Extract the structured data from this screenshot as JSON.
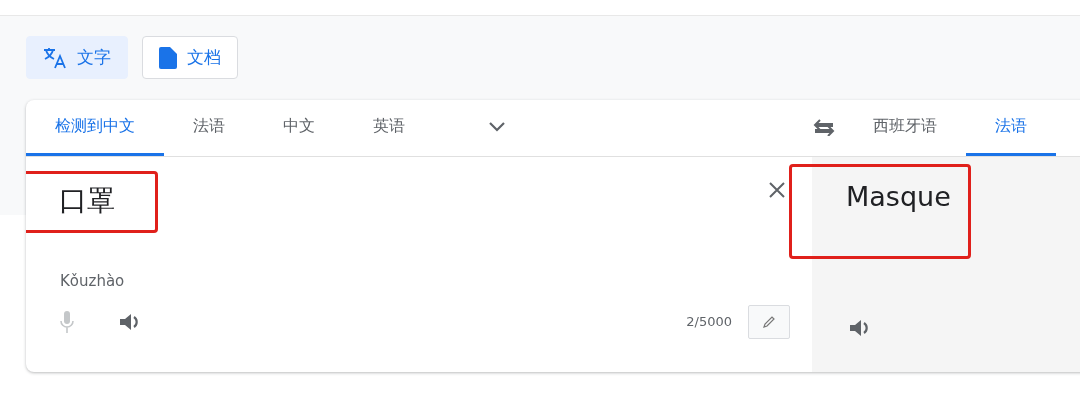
{
  "modes": [
    {
      "kind": "text",
      "label": "文字",
      "selected": true
    },
    {
      "kind": "document",
      "label": "文档",
      "selected": false
    }
  ],
  "source_languages": [
    {
      "label": "检测到中文",
      "selected": true
    },
    {
      "label": "法语",
      "selected": false
    },
    {
      "label": "中文",
      "selected": false
    },
    {
      "label": "英语",
      "selected": false
    }
  ],
  "target_languages": [
    {
      "label": "西班牙语",
      "selected": false
    },
    {
      "label": "法语",
      "selected": true
    }
  ],
  "source": {
    "text": "口罩",
    "highlighted": true,
    "romanization": "Kǒuzhào",
    "char_count": "2/5000",
    "mic_disabled": true
  },
  "translation": {
    "text": "Masque",
    "highlighted": true
  }
}
